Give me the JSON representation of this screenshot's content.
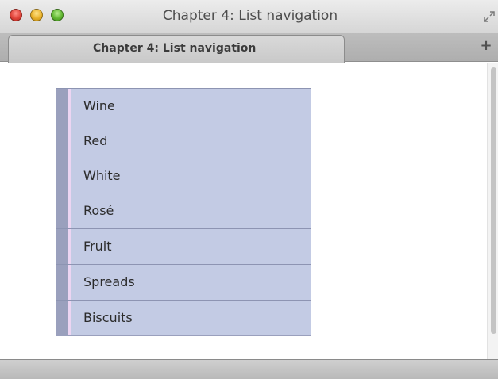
{
  "window": {
    "title": "Chapter 4: List navigation"
  },
  "tabs": [
    {
      "label": "Chapter 4: List navigation",
      "active": true
    }
  ],
  "tabbar": {
    "new_tab_label": "+"
  },
  "nav": {
    "groups": [
      {
        "items": [
          "Wine",
          "Red",
          "White",
          "Rosé"
        ]
      },
      {
        "items": [
          "Fruit"
        ]
      },
      {
        "items": [
          "Spreads"
        ]
      },
      {
        "items": [
          "Biscuits"
        ]
      }
    ]
  },
  "colors": {
    "list_background": "#c3cbe4",
    "list_stripe": "#9aa0bd",
    "list_accent": "#ecd5f2",
    "separator": "#8d94b2"
  },
  "icons": {
    "close": "close-icon",
    "minimize": "minimize-icon",
    "zoom": "zoom-icon",
    "fullscreen": "fullscreen-arrows-icon"
  }
}
